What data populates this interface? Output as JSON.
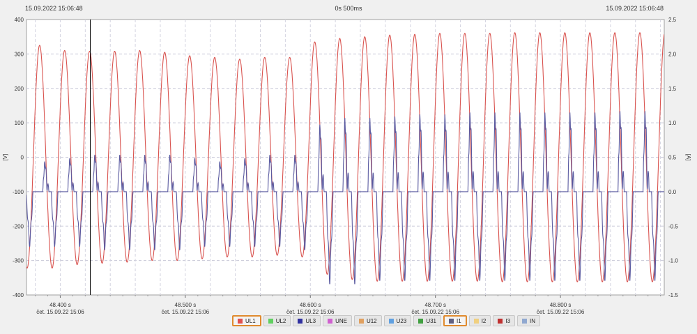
{
  "header": {
    "left_time": "15.09.2022 15:06:48",
    "center_span": "0s 500ms",
    "right_time": "15.09.2022 15:06:48"
  },
  "chart_data": {
    "type": "line",
    "y_left": {
      "label": "[V]",
      "range": [
        -400,
        400
      ],
      "ticks": [
        "400",
        "300",
        "200",
        "100",
        "0",
        "-100",
        "-200",
        "-300",
        "-400"
      ]
    },
    "y_right": {
      "label": "[A]",
      "range": [
        -1.5,
        2.5
      ],
      "ticks": [
        "2.5",
        "2.0",
        "1.5",
        "1.0",
        "0.5",
        "0.0",
        "-0.5",
        "-1.0",
        "-1.5"
      ]
    },
    "x_range": [
      48.373,
      48.883
    ],
    "x_ticks": [
      {
        "value": 48.4,
        "label": "48.400 s",
        "sub": "čet, 15.09.22 15:06"
      },
      {
        "value": 48.5,
        "label": "48.500 s",
        "sub": "čet, 15.09.22 15:06"
      },
      {
        "value": 48.6,
        "label": "48.600 s",
        "sub": "čet, 15.09.22 15:06"
      },
      {
        "value": 48.7,
        "label": "48.700 s",
        "sub": "čet, 15.09.22 15:06"
      },
      {
        "value": 48.8,
        "label": "48.800 s",
        "sub": "čet, 15.09.22 15:06"
      }
    ],
    "cursor_x": 48.424,
    "grid": true,
    "series": [
      {
        "name": "UL1",
        "axis": "left",
        "color": "#d9534f",
        "period_s": 0.02,
        "phase_s": 48.3785,
        "peaks": [
          325,
          310,
          308,
          308,
          310,
          305,
          295,
          290,
          285,
          290,
          290,
          335,
          345,
          350,
          355,
          357,
          360,
          360,
          360,
          362,
          362,
          362,
          362,
          362,
          362,
          362
        ],
        "troughs": [
          -322,
          -312,
          -308,
          -305,
          -300,
          -300,
          -295,
          -290,
          -290,
          -285,
          -290,
          -340,
          -355,
          -360,
          -360,
          -360,
          -360,
          -360,
          -362,
          -362,
          -362,
          -362,
          -362,
          -362,
          -362,
          -362
        ]
      },
      {
        "name": "I1",
        "axis": "right",
        "color": "#5a5aa0",
        "period_s": 0.02,
        "phase_s": 48.3785,
        "peaks": [
          0.45,
          0.5,
          0.55,
          0.55,
          0.55,
          0.55,
          0.5,
          0.45,
          0.5,
          0.55,
          0.55,
          1.0,
          1.1,
          1.1,
          1.12,
          1.15,
          1.15,
          1.18,
          1.18,
          1.18,
          1.18,
          1.18,
          1.18,
          1.2,
          1.2,
          1.2
        ],
        "troughs": [
          -0.8,
          -0.8,
          -0.85,
          -0.85,
          -0.85,
          -0.85,
          -0.8,
          -0.8,
          -0.8,
          -0.8,
          -0.85,
          -1.35,
          -1.35,
          -1.3,
          -1.3,
          -1.3,
          -1.3,
          -1.3,
          -1.3,
          -1.3,
          -1.3,
          -1.3,
          -1.3,
          -1.3,
          -1.3,
          -1.3
        ]
      }
    ]
  },
  "legend": [
    {
      "label": "UL1",
      "color": "#e05050",
      "active": true
    },
    {
      "label": "UL2",
      "color": "#60d060",
      "active": false
    },
    {
      "label": "UL3",
      "color": "#3030a0",
      "active": false
    },
    {
      "label": "UNE",
      "color": "#d060d0",
      "active": false
    },
    {
      "label": "U12",
      "color": "#e0a060",
      "active": false
    },
    {
      "label": "U23",
      "color": "#60a0e0",
      "active": false
    },
    {
      "label": "U31",
      "color": "#40a040",
      "active": false
    },
    {
      "label": "I1",
      "color": "#606080",
      "active": true
    },
    {
      "label": "I2",
      "color": "#f0d080",
      "active": false
    },
    {
      "label": "I3",
      "color": "#c03030",
      "active": false
    },
    {
      "label": "IN",
      "color": "#90a8d0",
      "active": false
    }
  ]
}
